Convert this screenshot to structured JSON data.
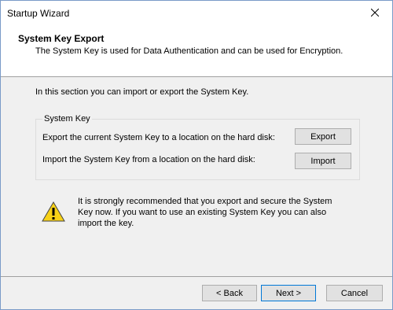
{
  "window": {
    "title": "Startup Wizard"
  },
  "header": {
    "title": "System Key Export",
    "subtitle": "The System Key is used for Data Authentication and can be used for Encryption."
  },
  "intro": "In this section you can import or export the System Key.",
  "group": {
    "title": "System Key",
    "export_label": "Export the current System Key to a location on the hard disk:",
    "export_button": "Export",
    "import_label": "Import the System Key from a location on the hard disk:",
    "import_button": "Import"
  },
  "warning": {
    "icon": "warning-icon",
    "text": "It is strongly recommended that you export and secure the System Key now. If you want to use an existing System Key you can also import the key."
  },
  "footer": {
    "back": "< Back",
    "next": "Next >",
    "cancel": "Cancel"
  },
  "colors": {
    "window_border": "#7a9bc8",
    "default_button_border": "#0078d7",
    "warning_yellow": "#f7d117"
  }
}
